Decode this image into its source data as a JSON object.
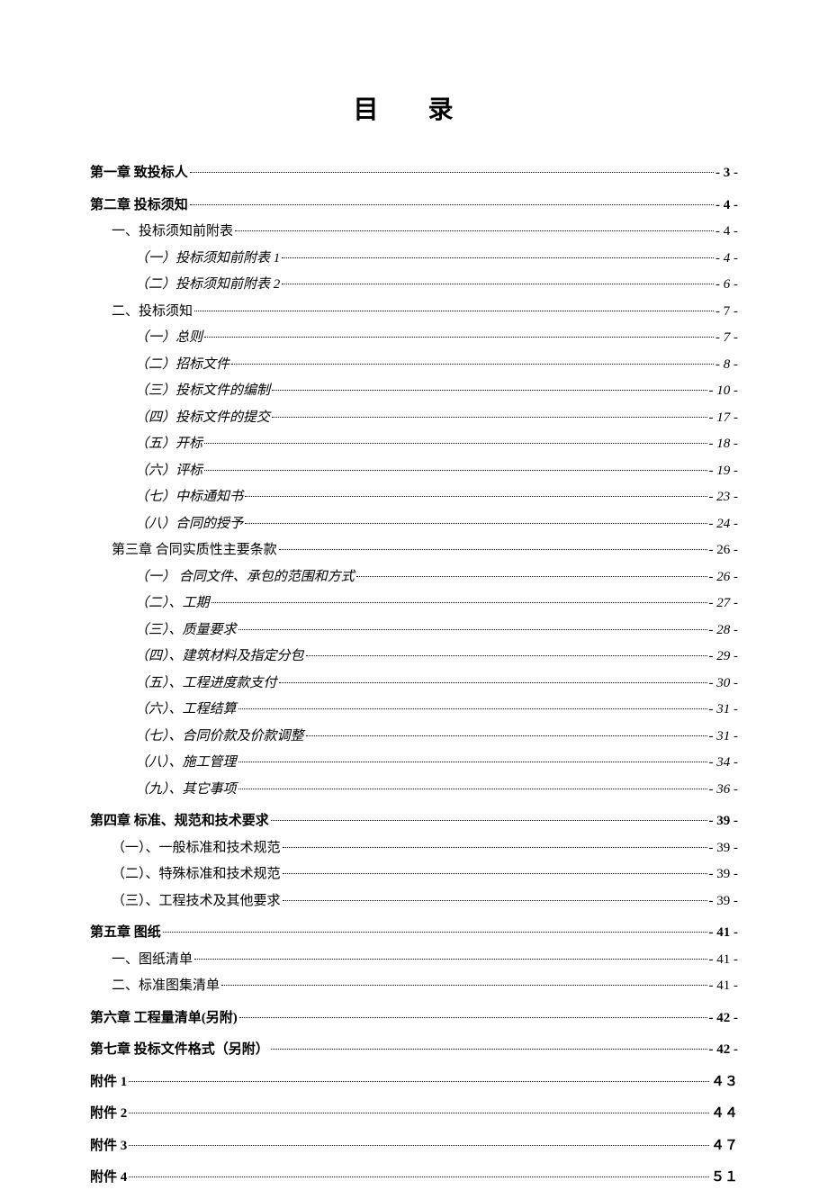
{
  "title": "目  录",
  "entries": [
    {
      "label": "第一章   致投标人",
      "page": "- 3 -",
      "level": 0
    },
    {
      "label": "第二章   投标须知",
      "page": "- 4 -",
      "level": 0
    },
    {
      "label": "一、投标须知前附表",
      "page": "- 4 -",
      "level": 1
    },
    {
      "label": "（一）投标须知前附表 1",
      "page": "- 4 -",
      "level": 2
    },
    {
      "label": "（二）投标须知前附表 2",
      "page": "- 6 -",
      "level": 2
    },
    {
      "label": "二、投标须知",
      "page": "- 7 -",
      "level": 1
    },
    {
      "label": "（一）总则",
      "page": "- 7 -",
      "level": 2
    },
    {
      "label": "（二）招标文件",
      "page": "- 8 -",
      "level": 2
    },
    {
      "label": "（三）投标文件的编制",
      "page": "- 10 -",
      "level": 2
    },
    {
      "label": "（四）投标文件的提交",
      "page": "- 17 -",
      "level": 2
    },
    {
      "label": "（五）开标",
      "page": "- 18 -",
      "level": 2
    },
    {
      "label": "（六）评标",
      "page": "- 19 -",
      "level": 2
    },
    {
      "label": "（七）中标通知书",
      "page": "- 23 -",
      "level": 2
    },
    {
      "label": "（八）合同的授予",
      "page": "- 24 -",
      "level": 2
    },
    {
      "label": "第三章 合同实质性主要条款",
      "page": "- 26 -",
      "level": 1
    },
    {
      "label": "（一）  合同文件、承包的范围和方式",
      "page": "- 26 -",
      "level": 2
    },
    {
      "label": "（二）、工期",
      "page": "- 27 -",
      "level": 2
    },
    {
      "label": "（三）、质量要求",
      "page": "- 28 -",
      "level": 2
    },
    {
      "label": "（四）、建筑材料及指定分包",
      "page": "- 29 -",
      "level": 2
    },
    {
      "label": "（五）、工程进度款支付",
      "page": "- 30 -",
      "level": 2
    },
    {
      "label": "（六）、工程结算",
      "page": "- 31 -",
      "level": 2
    },
    {
      "label": "（七）、合同价款及价款调整",
      "page": "- 31 -",
      "level": 2
    },
    {
      "label": "（八）、施工管理",
      "page": "- 34 -",
      "level": 2
    },
    {
      "label": "（九）、其它事项",
      "page": "- 36 -",
      "level": 2
    },
    {
      "label": "第四章   标准、规范和技术要求",
      "page": "- 39 -",
      "level": 0
    },
    {
      "label": "（一）、一般标准和技术规范",
      "page": "- 39 -",
      "level": 1
    },
    {
      "label": "（二）、特殊标准和技术规范",
      "page": "- 39 -",
      "level": 1
    },
    {
      "label": "（三）、工程技术及其他要求",
      "page": "- 39 -",
      "level": 1
    },
    {
      "label": "第五章   图纸",
      "page": "- 41 -",
      "level": 0
    },
    {
      "label": "一、图纸清单",
      "page": "- 41 -",
      "level": 1
    },
    {
      "label": "二、标准图集清单",
      "page": "- 41 -",
      "level": 1
    },
    {
      "label": "第六章   工程量清单(另附)",
      "page": "- 42 -",
      "level": 0
    },
    {
      "label": "第七章   投标文件格式（另附）",
      "page": "- 42 -",
      "level": 0
    },
    {
      "label": "附件 1",
      "page": "４３",
      "level": 0
    },
    {
      "label": "附件 2",
      "page": "４４",
      "level": 0
    },
    {
      "label": "附件 3",
      "page": "４７",
      "level": 0
    },
    {
      "label": "附件 4",
      "page": "５１",
      "level": 0
    }
  ]
}
